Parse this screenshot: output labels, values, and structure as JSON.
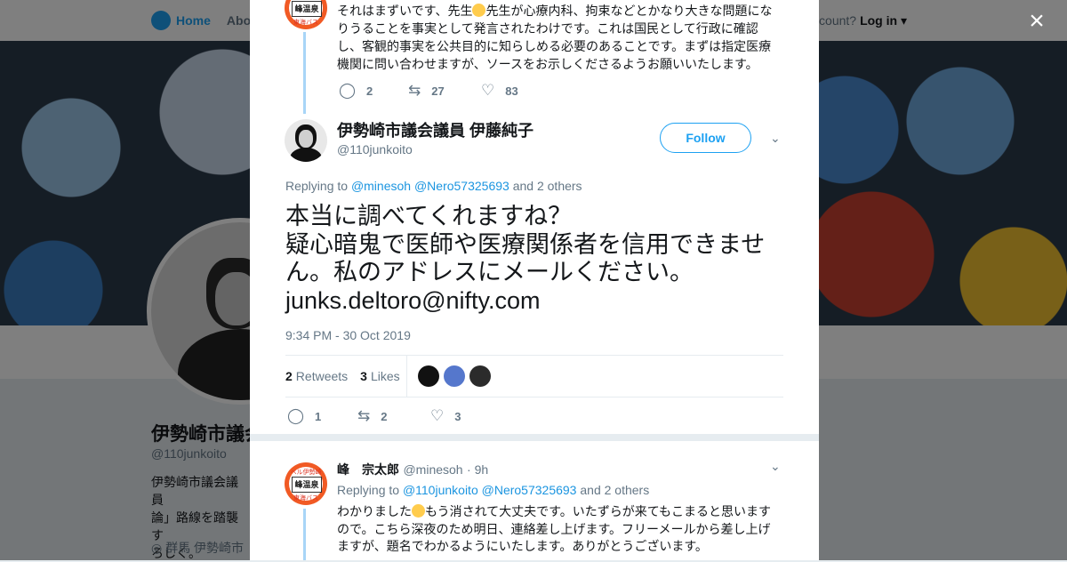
{
  "nav": {
    "home": "Home",
    "about": "Abo",
    "account_q": "count?",
    "login": "Log in"
  },
  "bg_profile": {
    "name": "伊勢崎市議会",
    "handle": "@110junkoito",
    "bio": "伊勢崎市議会議員\n論」路線を踏襲す\nろしく。",
    "location": "群馬 伊勢崎市"
  },
  "close_label": "×",
  "prev_tweet": {
    "text_a": "それはまずいです、先生",
    "text_b": "先生が心療内科、拘束などとかなり大きな問題にな",
    "text_c": "りうることを事実として発言されたわけです。これは国民として行政に確認",
    "text_d": "し、客観的事実を公共目的に知らしめる必要のあることです。まずは指定医療",
    "text_e": "機関に問い合わせますが、ソースをお示しくださるようお願いいたします。",
    "replies": "2",
    "retweets": "27",
    "likes": "83",
    "avatar_top": "ベル伊勢崎",
    "avatar_label": "峰温泉",
    "avatar_bottom": "東海バス"
  },
  "main_tweet": {
    "author_name": "伊勢崎市議会議員 伊藤純子",
    "handle": "@110junkoito",
    "follow_label": "Follow",
    "replying_prefix": "Replying to",
    "mention_1": "@minesoh",
    "mention_2": "@Nero57325693",
    "replying_suffix": "and 2 others",
    "line_1": "本当に調べてくれますね？",
    "line_2": "疑心暗鬼で医師や医療関係者を信用できませ",
    "line_3": "ん。私のアドレスにメールください。",
    "line_4": "junks.deltoro@nifty.com",
    "timestamp": "9:34 PM - 30 Oct 2019",
    "retweet_count": "2",
    "retweet_label": "Retweets",
    "like_count": "3",
    "like_label": "Likes",
    "replies": "1",
    "retweets": "2",
    "likes": "3"
  },
  "reply_tweet": {
    "author_name": "峰　宗太郎",
    "handle": "@minesoh",
    "time": "· 9h",
    "replying_prefix": "Replying to",
    "mention_1": "@110junkoito",
    "mention_2": "@Nero57325693",
    "replying_suffix": "and 2 others",
    "text_a": "わかりました",
    "text_b": "もう消されて大丈夫です。いたずらが来てもこまると思います",
    "text_c": "ので。こちら深夜のため明日、連絡差し上げます。フリーメールから差し上げ",
    "text_d": "ますが、題名でわかるようにいたします。ありがとうございます。"
  },
  "icons": [
    "twitter-bird-icon",
    "home-icon",
    "close-icon",
    "reply-icon",
    "retweet-icon",
    "heart-icon",
    "chevron-down-icon",
    "location-pin-icon"
  ],
  "colors": {
    "accent": "#1da1f2",
    "link": "#1b95e0",
    "text": "#14171a",
    "muted": "#657786",
    "thread": "#a8d5f7"
  }
}
